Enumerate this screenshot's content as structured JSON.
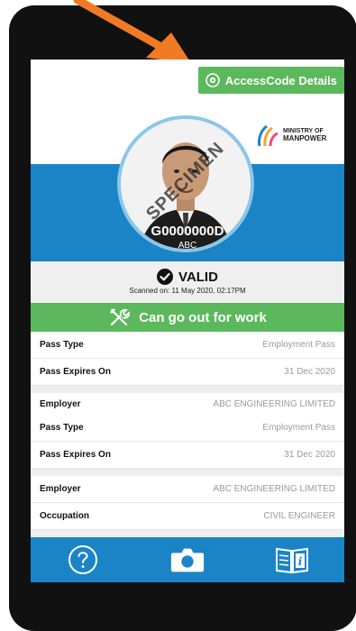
{
  "header": {
    "access_button_label": "AccessCode Details"
  },
  "ministry": {
    "line1": "MINISTRY OF",
    "line2": "MANPOWER"
  },
  "photo": {
    "watermark": "SPECIMEN"
  },
  "pass_holder": {
    "id_number": "G0000000D",
    "name": "ABC"
  },
  "validity": {
    "status": "VALID",
    "scanned": "Scanned on: 11 May 2020, 02:17PM"
  },
  "work_status": {
    "label": "Can go out for work"
  },
  "details": [
    {
      "label": "Pass Type",
      "value": "Employment Pass"
    },
    {
      "label": "Pass Expires On",
      "value": "31 Dec 2020"
    },
    {
      "label": "Employer",
      "value": "ABC ENGINEERING LIMITED"
    },
    {
      "label": "Pass Type",
      "value": "Employment Pass"
    },
    {
      "label": "Pass Expires On",
      "value": "31 Dec 2020"
    },
    {
      "label": "Employer",
      "value": "ABC ENGINEERING LIMITED"
    },
    {
      "label": "Occupation",
      "value": "CIVIL ENGINEER"
    }
  ],
  "nav": {
    "help_icon": "question-circle-icon",
    "camera_icon": "camera-icon",
    "info_icon": "info-book-icon"
  },
  "colors": {
    "primary_blue": "#1a84c7",
    "green": "#5cb85c",
    "annotation_arrow": "#f07b24"
  }
}
